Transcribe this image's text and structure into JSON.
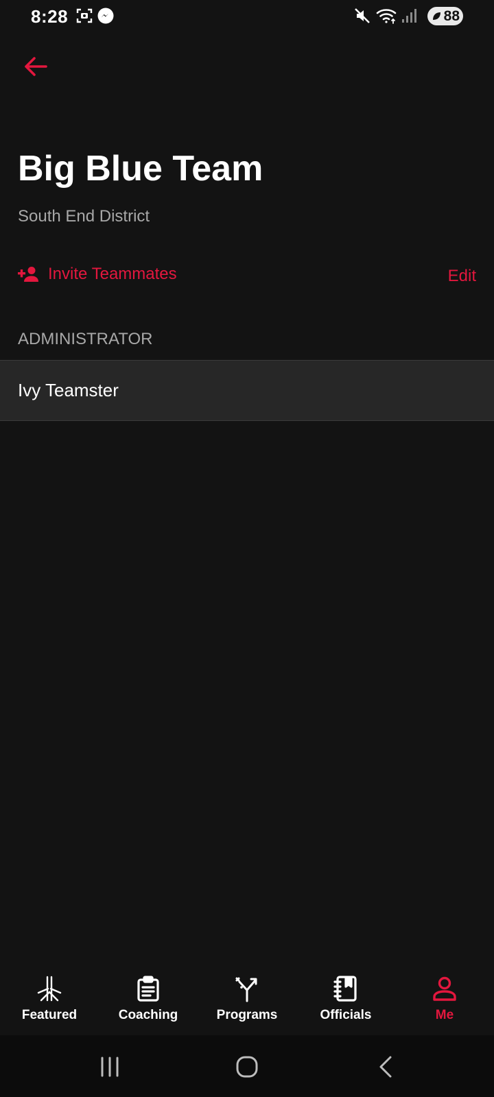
{
  "status_bar": {
    "time": "8:28",
    "battery": "88",
    "icons": [
      "screenshot-icon",
      "messenger-icon",
      "mute-icon",
      "wifi-icon",
      "signal-icon",
      "battery-icon"
    ]
  },
  "header": {
    "back_icon": "arrow-left-icon",
    "title": "Big Blue Team",
    "subtitle": "South End District"
  },
  "actions": {
    "invite_label": "Invite Teammates",
    "invite_icon": "person-add-icon",
    "edit_label": "Edit"
  },
  "sections": [
    {
      "header": "ADMINISTRATOR",
      "members": [
        {
          "name": "Ivy Teamster"
        }
      ]
    }
  ],
  "bottom_nav": {
    "items": [
      {
        "label": "Featured",
        "icon": "featured-icon",
        "active": false
      },
      {
        "label": "Coaching",
        "icon": "clipboard-icon",
        "active": false
      },
      {
        "label": "Programs",
        "icon": "programs-icon",
        "active": false
      },
      {
        "label": "Officials",
        "icon": "rulebook-icon",
        "active": false
      },
      {
        "label": "Me",
        "icon": "person-icon",
        "active": true
      }
    ]
  },
  "colors": {
    "background": "#131313",
    "accent": "#e3173e",
    "secondary_text": "#a8a8a8",
    "row_background": "#272727"
  }
}
